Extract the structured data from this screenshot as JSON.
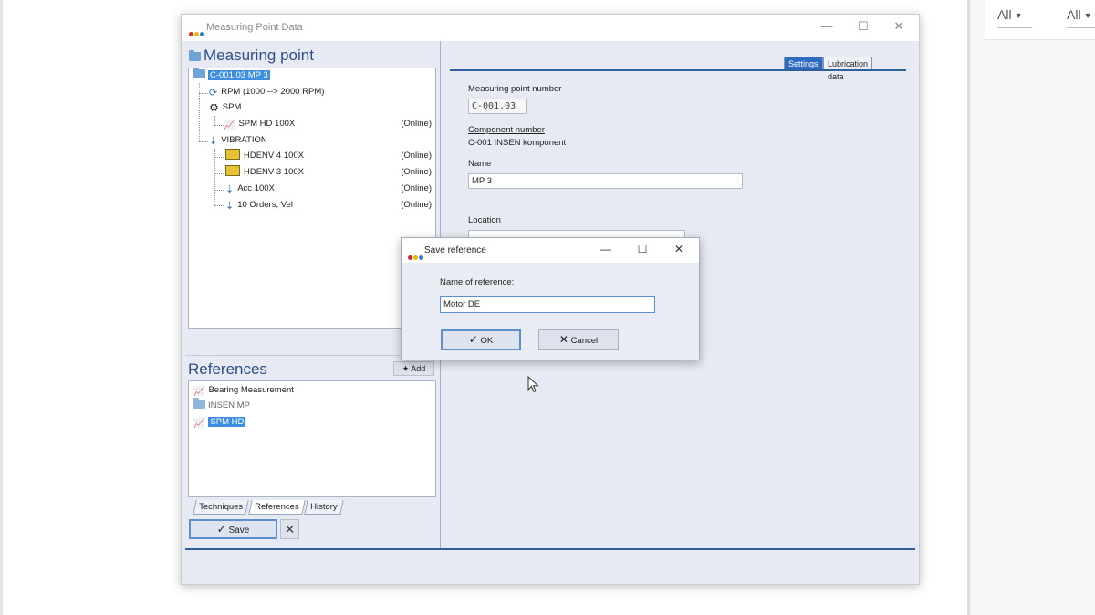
{
  "window": {
    "title": "Measuring Point Data",
    "minimize": "—",
    "maximize": "☐",
    "close": "✕",
    "logo_colors": [
      "#d42a2a",
      "#f0b400",
      "#2a7fd4"
    ]
  },
  "filters": [
    {
      "label": "All"
    },
    {
      "label": "All"
    }
  ],
  "measuring_point": {
    "title": "Measuring point",
    "tree": [
      {
        "label": "C-001.03 MP 3",
        "status": "",
        "icon": "folder-icon",
        "selected": true
      },
      {
        "label": "RPM   (1000 --> 2000 RPM)",
        "status": "",
        "icon": "rpm-icon"
      },
      {
        "label": "SPM",
        "status": "",
        "icon": "spm-icon"
      },
      {
        "label": "SPM HD 100X",
        "status": "(Online)",
        "icon": "measurement-icon"
      },
      {
        "label": "VIBRATION",
        "status": "",
        "icon": "vibration-icon"
      },
      {
        "label": "HDENV 4 100X",
        "status": "(Online)",
        "icon": "hd-env-icon"
      },
      {
        "label": "HDENV 3 100X",
        "status": "(Online)",
        "icon": "hd-env-icon"
      },
      {
        "label": "Acc 100X",
        "status": "(Online)",
        "icon": "vibration-icon"
      },
      {
        "label": "10 Orders, Vel",
        "status": "(Online)",
        "icon": "vibration-icon"
      }
    ]
  },
  "references": {
    "title": "References",
    "add_label": "Add",
    "items": [
      {
        "label": "Bearing Measurement",
        "icon": "measurement-icon"
      },
      {
        "label": "INSEN MP",
        "icon": "folder-icon"
      },
      {
        "label": "SPM HD",
        "icon": "measurement-icon",
        "selected": true
      }
    ]
  },
  "bottom_tabs": [
    {
      "label": "Techniques"
    },
    {
      "label": "References",
      "active": true
    },
    {
      "label": "History"
    }
  ],
  "save_label": "Save",
  "right_tabs": [
    {
      "label": "Settings",
      "active": true
    },
    {
      "label": "Lubrication data"
    }
  ],
  "form": {
    "mp_number_label": "Measuring point number",
    "mp_number_value": "C-001.03",
    "component_number_label": "Component number",
    "component_number_value": "C-001  INSEN komponent",
    "name_label": "Name",
    "name_value": "MP 3",
    "location_label": "Location"
  },
  "dialog": {
    "title": "Save reference",
    "minimize": "—",
    "maximize": "☐",
    "close": "✕",
    "field_label": "Name of reference:",
    "field_value": "Motor DE",
    "ok_label": "OK",
    "cancel_label": "Cancel"
  }
}
